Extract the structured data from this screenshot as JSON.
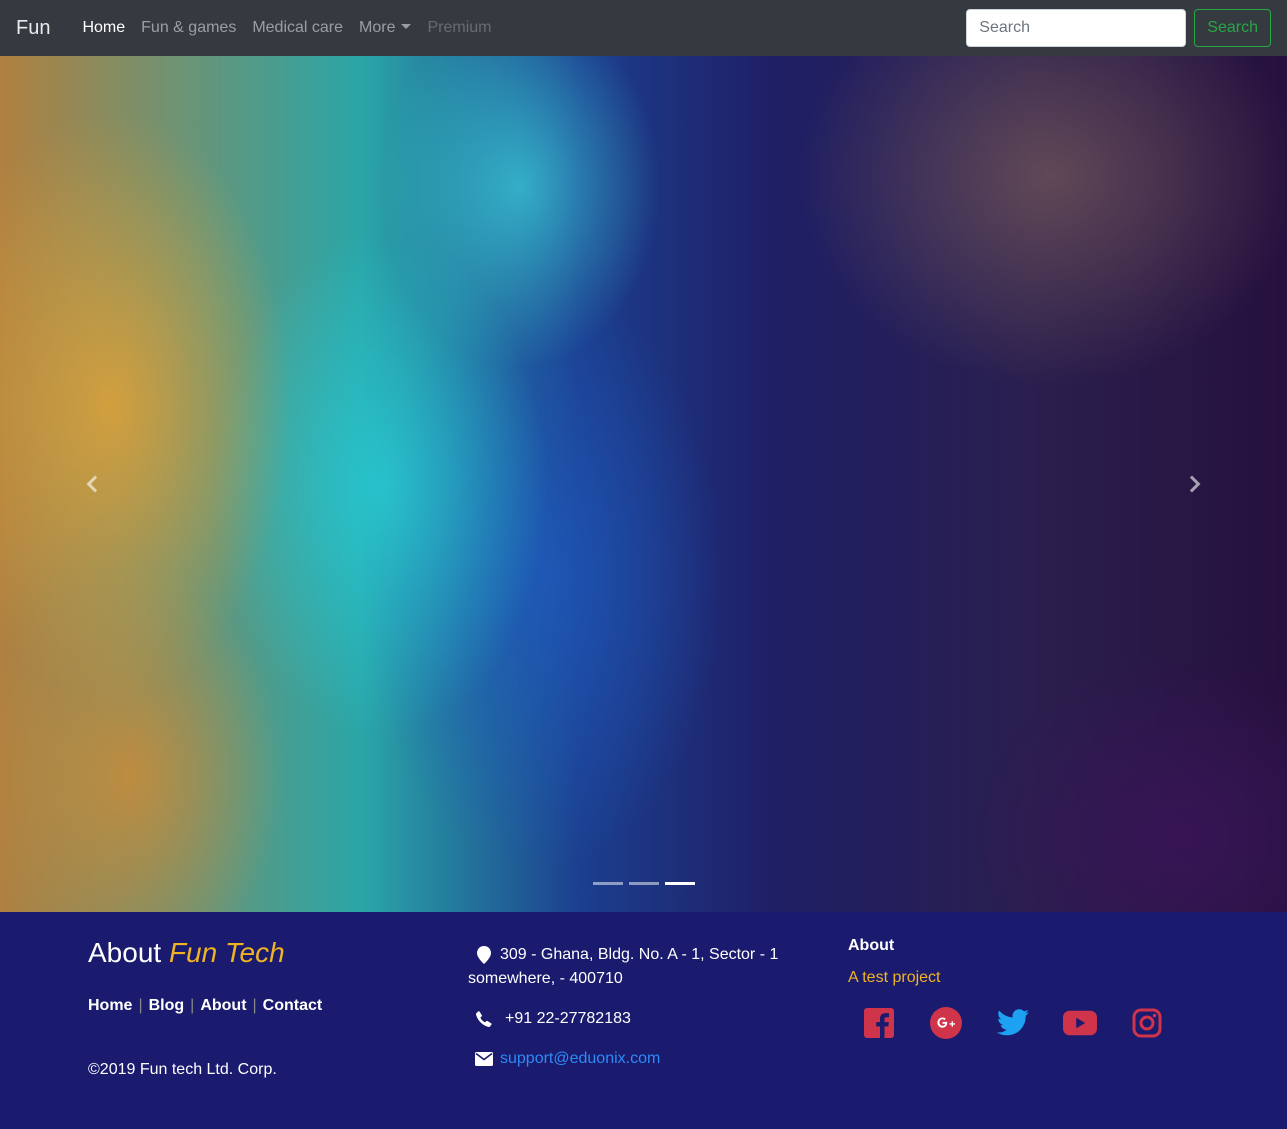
{
  "navbar": {
    "brand": "Fun",
    "links": [
      {
        "label": "Home"
      },
      {
        "label": "Fun & games"
      },
      {
        "label": "Medical care"
      },
      {
        "label": "More"
      },
      {
        "label": "Premium"
      }
    ],
    "search": {
      "placeholder": "Search",
      "button_label": "Search"
    }
  },
  "carousel": {
    "slides": 3,
    "active_slide": 3,
    "prev_icon": "chevron-left-icon",
    "next_icon": "chevron-right-icon"
  },
  "footer": {
    "about": {
      "prefix": "About",
      "brand": "Fun Tech"
    },
    "links": [
      "Home",
      "Blog",
      "About",
      "Contact"
    ],
    "copyright": "©2019 Fun tech Ltd. Corp.",
    "contact": {
      "address_line1": "309 - Ghana, Bldg. No. A - 1, Sector - 1",
      "address_line2": "somewhere, - 400710",
      "phone": "+91 22-27782183",
      "email": "support@eduonix.com"
    },
    "about_section": {
      "title": "About",
      "description": "A test project"
    },
    "socials": [
      "facebook-icon",
      "google-plus-icon",
      "twitter-icon",
      "youtube-icon",
      "instagram-icon"
    ]
  },
  "colors": {
    "navbar_bg": "#343a40",
    "footer_bg": "#1a1a6e",
    "accent_yellow": "#f0b423",
    "success_green": "#28a745",
    "link_blue": "#2d8bf5",
    "social_red": "#d0344a",
    "twitter_blue": "#1da1f2"
  }
}
